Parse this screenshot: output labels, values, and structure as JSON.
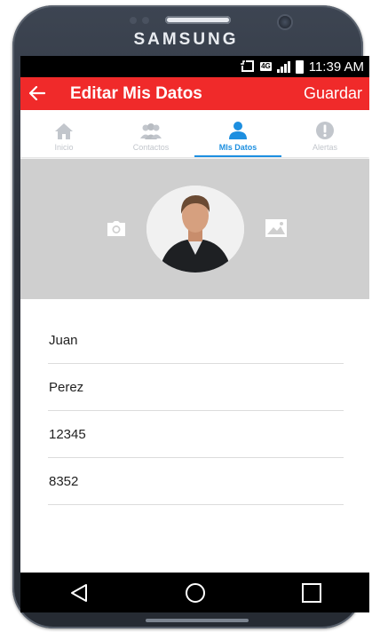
{
  "device": {
    "brand": "SAMSUNG"
  },
  "status_bar": {
    "time": "11:39 AM",
    "network": "4G"
  },
  "app_bar": {
    "title": "Editar Mis Datos",
    "action_label": "Guardar",
    "back_icon": "arrow-left-icon",
    "color": "#f02a2a"
  },
  "tabs": [
    {
      "label": "Inicio",
      "icon": "home-icon",
      "active": false
    },
    {
      "label": "Contactos",
      "icon": "group-icon",
      "active": false
    },
    {
      "label": "MIs Datos",
      "icon": "person-icon",
      "active": true
    },
    {
      "label": "Alertas",
      "icon": "alert-icon",
      "active": false
    }
  ],
  "profile": {
    "camera_icon": "camera-icon",
    "gallery_icon": "image-icon"
  },
  "form": {
    "fields": [
      {
        "value": "Juan"
      },
      {
        "value": "Perez"
      },
      {
        "value": "12345"
      },
      {
        "value": "8352"
      }
    ]
  },
  "nav_bar": {
    "back": "triangle-back-icon",
    "home": "circle-home-icon",
    "recents": "square-recents-icon"
  },
  "colors": {
    "accent": "#1d8fe0",
    "header_bg": "#cfcfcf"
  }
}
